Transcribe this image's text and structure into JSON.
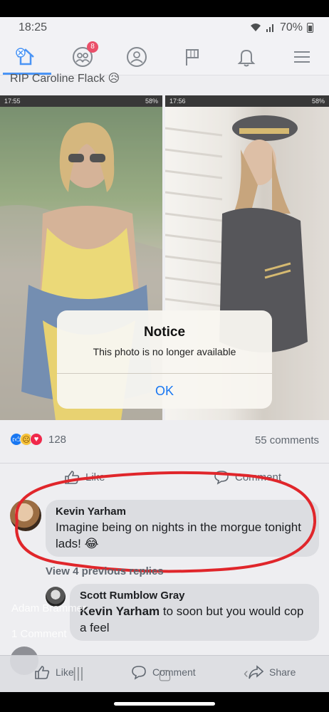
{
  "status_bar": {
    "time": "18:25",
    "battery": "70%"
  },
  "post": {
    "caption": "RIP Caroline Flack 😥"
  },
  "nav": {
    "friend_requests_badge": "8",
    "accent": "#1877f2",
    "badge_color": "#e41e3f"
  },
  "screenshots": {
    "left": {
      "time": "17:55",
      "battery": "58%"
    },
    "right": {
      "time": "17:56",
      "battery": "58%"
    }
  },
  "dialog": {
    "title": "Notice",
    "message": "This photo is no longer available",
    "ok_label": "OK"
  },
  "reactions": {
    "count": "128",
    "comments_label": "55 comments"
  },
  "actions": {
    "like": "Like",
    "comment": "Comment"
  },
  "comments": [
    {
      "name": "Kevin Yarham",
      "text": "Imagine being on nights in the morgue tonight lads! 😂"
    }
  ],
  "view_previous": "View 4 previous replies",
  "reply": {
    "name": "Scott Rumblow Gray",
    "mention": "Kevin Yarham",
    "text": " to soon but you would cop a feel"
  },
  "overlay_ghost": {
    "name": "Adam Brammer",
    "comments": "1 Comment"
  },
  "bottom_bar": {
    "like": "Like",
    "comment": "Comment",
    "share": "Share"
  },
  "annotation_color": "#e0262b"
}
